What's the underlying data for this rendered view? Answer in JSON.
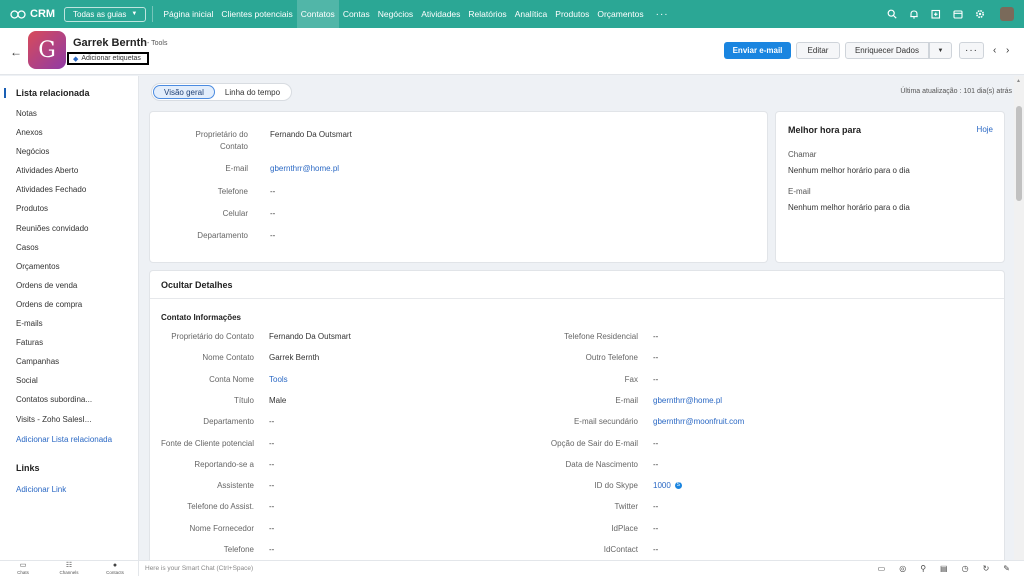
{
  "topnav": {
    "brand": "CRM",
    "tab_selector": "Todas as guias",
    "items": [
      "Página inicial",
      "Clientes potenciais",
      "Contatos",
      "Contas",
      "Negócios",
      "Atividades",
      "Relatórios",
      "Analítica",
      "Produtos",
      "Orçamentos"
    ],
    "active_index": 2,
    "more": "···",
    "icons": [
      "search-icon",
      "bell-icon",
      "add-icon",
      "calendar-icon",
      "settings-icon",
      "user-avatar"
    ]
  },
  "record": {
    "avatar_letter": "G",
    "name": "Garrek Bernth",
    "account": "- Tools",
    "tag_button": "Adicionar etiquetas",
    "send_email": "Enviar e-mail",
    "edit": "Editar",
    "enrich": "Enriquecer Dados",
    "more": "···"
  },
  "sidebar": {
    "title": "Lista relacionada",
    "items": [
      "Notas",
      "Anexos",
      "Negócios",
      "Atividades Aberto",
      "Atividades Fechado",
      "Produtos",
      "Reuniões convidado",
      "Casos",
      "Orçamentos",
      "Ordens de venda",
      "Ordens de compra",
      "E-mails",
      "Faturas",
      "Campanhas",
      "Social",
      "Contatos subordina...",
      "Visits - Zoho SalesI..."
    ],
    "add_related": "Adicionar Lista relacionada",
    "links_title": "Links",
    "add_link": "Adicionar Link"
  },
  "view_tabs": [
    "Visão geral",
    "Linha do tempo"
  ],
  "last_update": "Última atualização : 101 dia(s) atrás",
  "overview": [
    {
      "label": "Proprietário do Contato",
      "value": "Fernando Da Outsmart",
      "link": false
    },
    {
      "label": "E-mail",
      "value": "gbernthrr@home.pl",
      "link": true
    },
    {
      "label": "Telefone",
      "value": "--",
      "link": false
    },
    {
      "label": "Celular",
      "value": "--",
      "link": false
    },
    {
      "label": "Departamento",
      "value": "--",
      "link": false
    }
  ],
  "best_time": {
    "title": "Melhor hora para",
    "today": "Hoje",
    "call_label": "Chamar",
    "call_value": "Nenhum melhor horário para o dia",
    "email_label": "E-mail",
    "email_value": "Nenhum melhor horário para o dia"
  },
  "details": {
    "title": "Ocultar Detalhes",
    "section": "Contato Informações",
    "left": [
      {
        "label": "Proprietário do Contato",
        "value": "Fernando Da Outsmart",
        "link": false
      },
      {
        "label": "Nome Contato",
        "value": "Garrek Bernth",
        "link": false
      },
      {
        "label": "Conta Nome",
        "value": "Tools",
        "link": true
      },
      {
        "label": "Título",
        "value": "Male",
        "link": false
      },
      {
        "label": "Departamento",
        "value": "--",
        "link": false
      },
      {
        "label": "Fonte de Cliente potencial",
        "value": "--",
        "link": false
      },
      {
        "label": "Reportando-se a",
        "value": "--",
        "link": false
      },
      {
        "label": "Assistente",
        "value": "--",
        "link": false
      },
      {
        "label": "Telefone do Assist.",
        "value": "--",
        "link": false
      },
      {
        "label": "Nome Fornecedor",
        "value": "--",
        "link": false
      },
      {
        "label": "Telefone",
        "value": "--",
        "link": false
      }
    ],
    "right": [
      {
        "label": "Telefone Residencial",
        "value": "--",
        "link": false
      },
      {
        "label": "Outro Telefone",
        "value": "--",
        "link": false
      },
      {
        "label": "Fax",
        "value": "--",
        "link": false
      },
      {
        "label": "E-mail",
        "value": "gbernthrr@home.pl",
        "link": true
      },
      {
        "label": "E-mail secundário",
        "value": "gbernthrr@moonfruit.com",
        "link": true
      },
      {
        "label": "Opção de Sair do E-mail",
        "value": "--",
        "link": false
      },
      {
        "label": "Data de Nascimento",
        "value": "--",
        "link": false
      },
      {
        "label": "ID do Skype",
        "value": "1000",
        "link": true
      },
      {
        "label": "Twitter",
        "value": "--",
        "link": false
      },
      {
        "label": "IdPlace",
        "value": "--",
        "link": false
      },
      {
        "label": "IdContact",
        "value": "--",
        "link": false
      }
    ]
  },
  "bottombar": {
    "items": [
      {
        "label": "Chats",
        "icon": "chat-icon"
      },
      {
        "label": "Channels",
        "icon": "channels-icon"
      },
      {
        "label": "Contacts",
        "icon": "contacts-icon"
      }
    ],
    "chat_placeholder": "Here is your Smart Chat (Ctrl+Space)"
  }
}
